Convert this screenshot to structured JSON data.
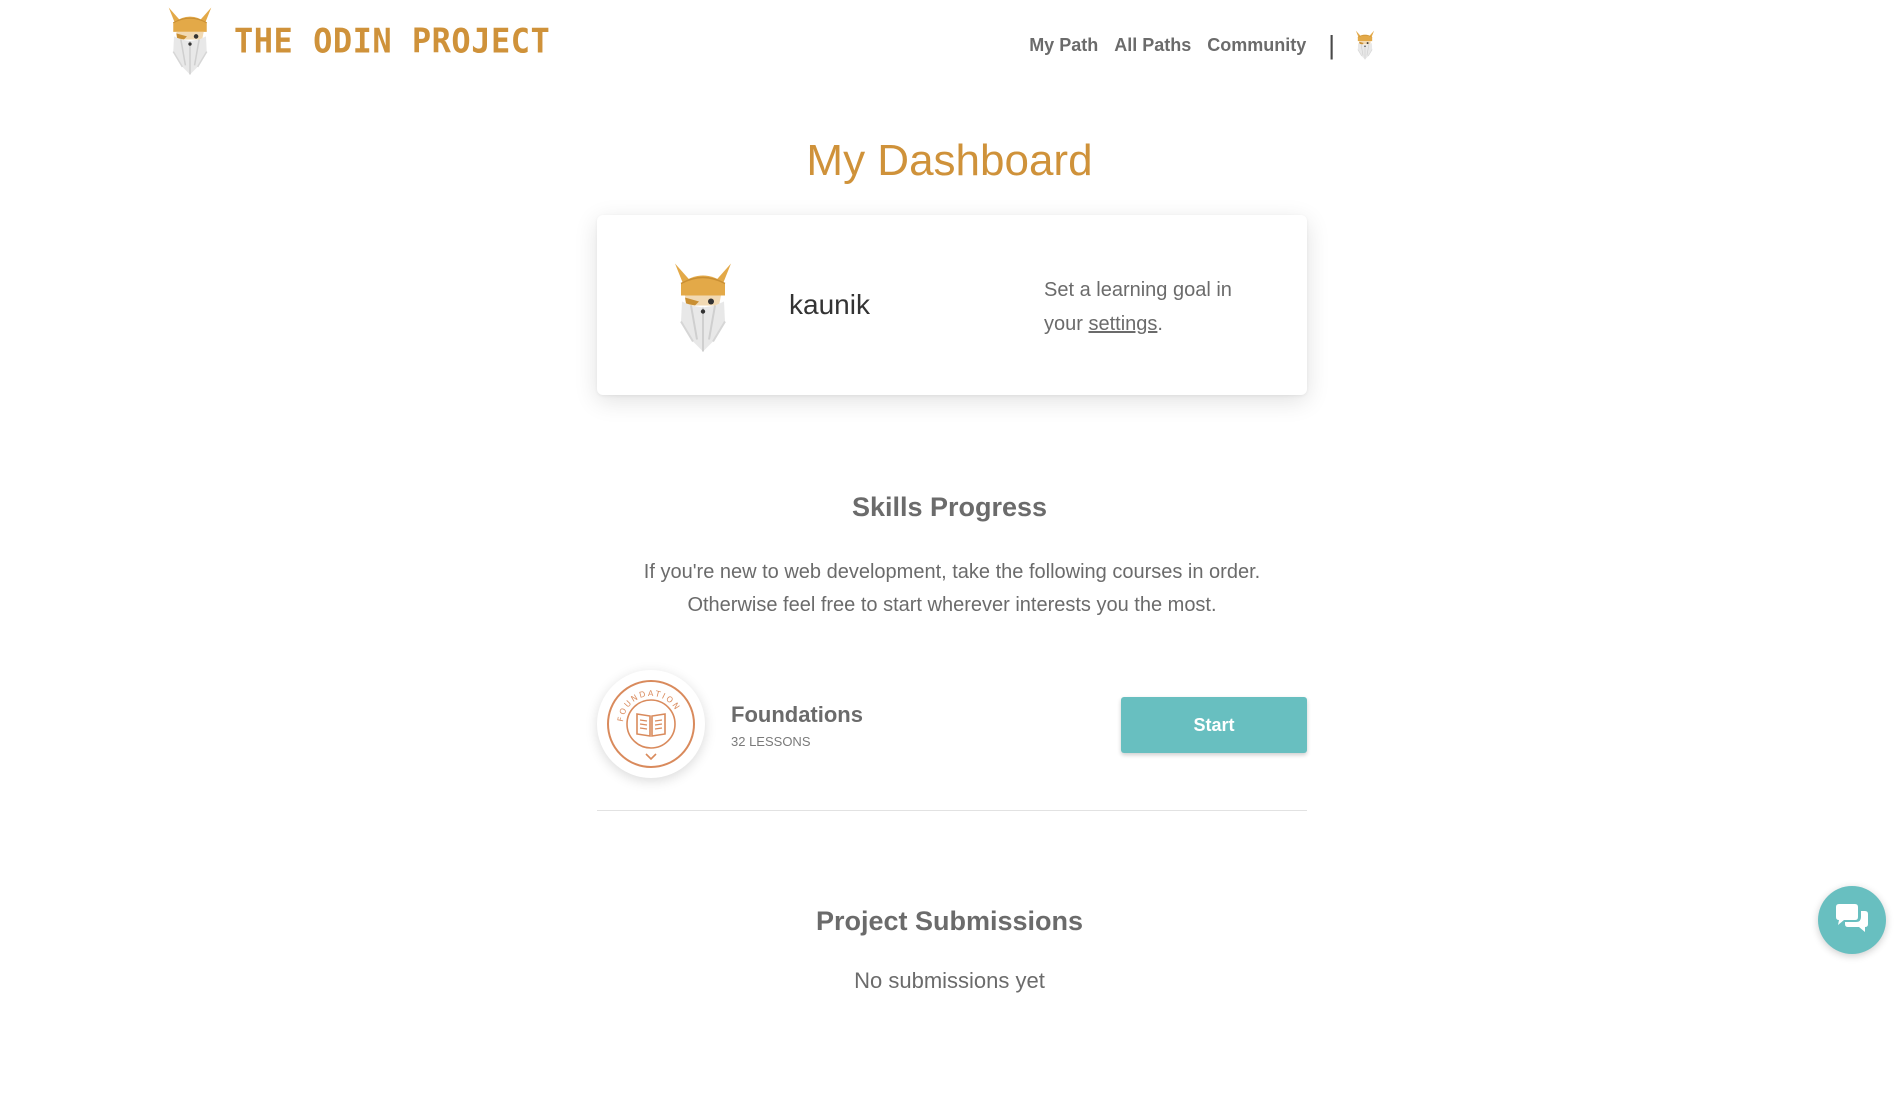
{
  "header": {
    "logo_text": "THE ODIN PROJECT",
    "nav": [
      {
        "label": "My Path"
      },
      {
        "label": "All Paths"
      },
      {
        "label": "Community"
      }
    ],
    "separator": "|"
  },
  "page": {
    "title": "My Dashboard"
  },
  "profile": {
    "username": "kaunik",
    "goal_prefix": "Set a learning goal in your ",
    "goal_link": "settings",
    "goal_suffix": "."
  },
  "skills": {
    "title": "Skills Progress",
    "description": "If you're new to web development, take the following courses in order. Otherwise feel free to start wherever interests you the most.",
    "courses": [
      {
        "name": "Foundations",
        "lessons": "32 LESSONS",
        "button": "Start",
        "badge_text": "FOUNDATION"
      }
    ]
  },
  "submissions": {
    "title": "Project Submissions",
    "empty": "No submissions yet"
  },
  "icons": {
    "logo": "odin-viking-icon",
    "avatar": "odin-viking-icon",
    "chat": "chat-bubbles-icon"
  },
  "colors": {
    "brand": "#cf923a",
    "accent": "#68bfc0",
    "badge": "#d98a5c",
    "text": "#6b6b6b"
  }
}
